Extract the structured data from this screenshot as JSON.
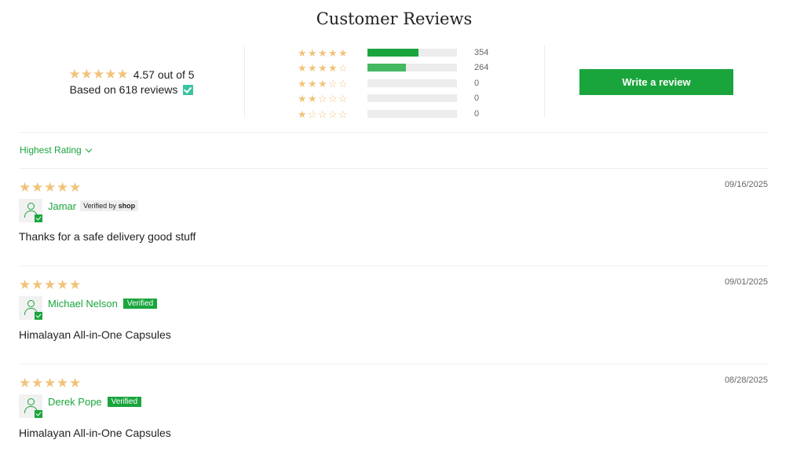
{
  "title": "Customer Reviews",
  "summary": {
    "average_text": "4.57 out of 5",
    "average_value": 4.57,
    "based_on": "Based on 618 reviews"
  },
  "histogram": [
    {
      "stars": 5,
      "count": "354",
      "fraction": 0.57
    },
    {
      "stars": 4,
      "count": "264",
      "fraction": 0.43
    },
    {
      "stars": 3,
      "count": "0",
      "fraction": 0
    },
    {
      "stars": 2,
      "count": "0",
      "fraction": 0
    },
    {
      "stars": 1,
      "count": "0",
      "fraction": 0
    }
  ],
  "write_button": "Write a review",
  "sort_label": "Highest Rating",
  "reviews": [
    {
      "rating": 5,
      "date": "09/16/2025",
      "author": "Jamar",
      "badge": "Verified by",
      "badge_brand": "shop",
      "text": "Thanks for a safe delivery good stuff"
    },
    {
      "rating": 5,
      "date": "09/01/2025",
      "author": "Michael Nelson",
      "badge": "Verified",
      "text": "Himalayan All-in-One Capsules"
    },
    {
      "rating": 5,
      "date": "08/28/2025",
      "author": "Derek Pope",
      "badge": "Verified",
      "text": "Himalayan All-in-One Capsules"
    }
  ],
  "colors": {
    "accent": "#1aa53c",
    "star": "#f1c37a",
    "track": "#ececec"
  },
  "icons": {
    "star": "star-icon",
    "avatar": "user-avatar-icon",
    "check": "verified-check-icon",
    "chevron": "chevron-down-icon"
  }
}
